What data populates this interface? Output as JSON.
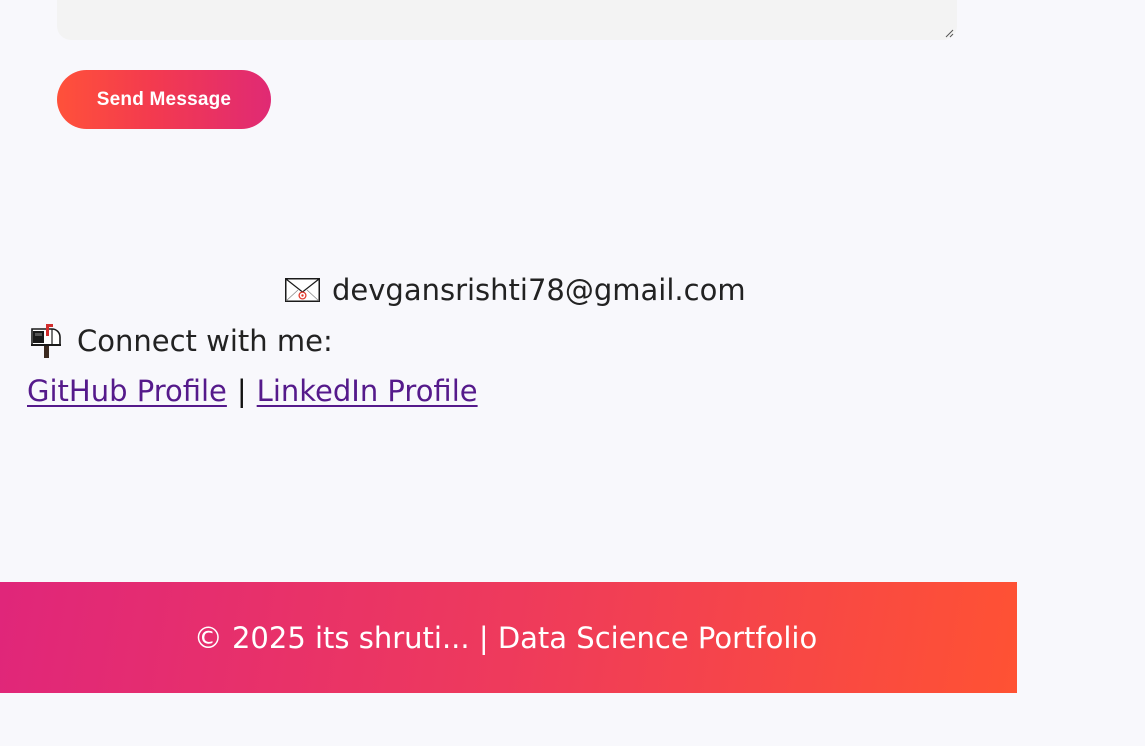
{
  "contact_form": {
    "message_value": "",
    "send_button_label": "Send Message"
  },
  "contact_info": {
    "email": "devgansrishti78@gmail.com",
    "connect_label": "Connect with me:",
    "links": [
      {
        "label": "GitHub Profile"
      },
      {
        "label": "LinkedIn Profile"
      }
    ],
    "link_separator": "|"
  },
  "footer": {
    "text": "© 2025 its shruti... | Data Science Portfolio"
  },
  "colors": {
    "button_gradient_start": "#ff513a",
    "button_gradient_end": "#e02a74",
    "footer_gradient_start": "#e0267a",
    "footer_gradient_end": "#ff5233",
    "visited_link": "#551a8b",
    "page_background": "#f8f8fc"
  },
  "icons": {
    "email_icon": "envelope-icon",
    "connect_icon": "mailbox-icon"
  }
}
